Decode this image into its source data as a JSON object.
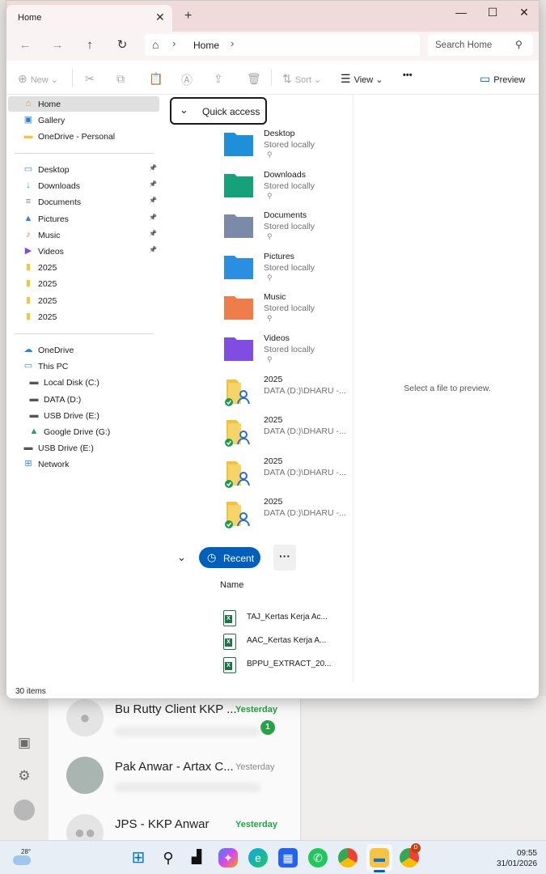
{
  "explorer": {
    "tab_title": "Home",
    "tab_close": "✕",
    "new_tab": "+",
    "window_controls": {
      "minimize": "—",
      "maximize": "☐",
      "close": "✕"
    },
    "address": {
      "crumb": "Home",
      "separator": "›"
    },
    "search_placeholder": "Search Home",
    "toolbar": {
      "new_label": "New",
      "sort_label": "Sort",
      "view_label": "View",
      "more_label": "•••",
      "preview_label": "Preview"
    },
    "sidebar": {
      "top": [
        {
          "label": "Home",
          "icon": "home-icon",
          "color": "#e8843a",
          "selected": true
        },
        {
          "label": "Gallery",
          "icon": "gallery-icon",
          "color": "#2d7fd3"
        },
        {
          "label": "OneDrive - Personal",
          "icon": "folder-icon",
          "color": "#f6c343"
        }
      ],
      "pinned": [
        {
          "label": "Desktop",
          "icon": "desktop-icon",
          "color": "#2a8fd8"
        },
        {
          "label": "Downloads",
          "icon": "download-icon",
          "color": "#1b9c6e"
        },
        {
          "label": "Documents",
          "icon": "documents-icon",
          "color": "#7c8aa6"
        },
        {
          "label": "Pictures",
          "icon": "pictures-icon",
          "color": "#2d86d8"
        },
        {
          "label": "Music",
          "icon": "music-icon",
          "color": "#e8703a"
        },
        {
          "label": "Videos",
          "icon": "videos-icon",
          "color": "#7e4bd8"
        },
        {
          "label": "2025",
          "icon": "shared-folder-icon",
          "color": "#f6c343"
        },
        {
          "label": "2025",
          "icon": "shared-folder-icon",
          "color": "#f6c343"
        },
        {
          "label": "2025",
          "icon": "shared-folder-icon",
          "color": "#f6c343"
        },
        {
          "label": "2025",
          "icon": "shared-folder-icon",
          "color": "#f6c343"
        }
      ],
      "drives": [
        {
          "label": "OneDrive",
          "icon": "cloud-icon",
          "color": "#2d86d8"
        },
        {
          "label": "This PC",
          "icon": "pc-icon",
          "color": "#2a8fd8"
        },
        {
          "label": "Local Disk (C:)",
          "icon": "windows-drive-icon",
          "color": "#555"
        },
        {
          "label": "DATA (D:)",
          "icon": "drive-icon",
          "color": "#555"
        },
        {
          "label": "USB Drive (E:)",
          "icon": "drive-icon",
          "color": "#555"
        },
        {
          "label": "Google Drive (G:)",
          "icon": "google-drive-icon",
          "color": "#1fa463"
        },
        {
          "label": "USB Drive (E:)",
          "icon": "drive-icon",
          "color": "#555"
        },
        {
          "label": "Network",
          "icon": "network-icon",
          "color": "#2a8fd8"
        }
      ]
    },
    "quick_access": {
      "header": "Quick access",
      "items": [
        {
          "name": "Desktop",
          "sub": "Stored locally",
          "icon": "desktop-folder-icon",
          "color": "#1f8fd8"
        },
        {
          "name": "Downloads",
          "sub": "Stored locally",
          "icon": "downloads-folder-icon",
          "color": "#18a17a"
        },
        {
          "name": "Documents",
          "sub": "Stored locally",
          "icon": "documents-folder-icon",
          "color": "#7b8aa8"
        },
        {
          "name": "Pictures",
          "sub": "Stored locally",
          "icon": "pictures-folder-icon",
          "color": "#2a8ee0"
        },
        {
          "name": "Music",
          "sub": "Stored locally",
          "icon": "music-folder-icon",
          "color": "#ee7d4a"
        },
        {
          "name": "Videos",
          "sub": "Stored locally",
          "icon": "videos-folder-icon",
          "color": "#7f4ee0"
        },
        {
          "name": "2025",
          "sub": "DATA (D:)\\DHARU -...",
          "icon": "shared-folder-icon",
          "color": "#f3c13c"
        },
        {
          "name": "2025",
          "sub": "DATA (D:)\\DHARU -...",
          "icon": "shared-folder-icon",
          "color": "#f3c13c"
        },
        {
          "name": "2025",
          "sub": "DATA (D:)\\DHARU -...",
          "icon": "shared-folder-icon",
          "color": "#f3c13c"
        },
        {
          "name": "2025",
          "sub": "DATA (D:)\\DHARU -...",
          "icon": "shared-folder-icon",
          "color": "#f3c13c"
        }
      ]
    },
    "recent": {
      "label": "Recent",
      "more": "···",
      "column_name": "Name",
      "files": [
        {
          "name": "TAJ_Kertas Kerja Ac..."
        },
        {
          "name": "AAC_Kertas Kerja A..."
        },
        {
          "name": "BPPU_EXTRACT_20..."
        }
      ]
    },
    "preview_text": "Select a file to preview.",
    "status": "30 items"
  },
  "background_chats": [
    {
      "name": "Bu Rutty Client KKP ...",
      "time": "Yesterday",
      "unread": "1"
    },
    {
      "name": "Pak Anwar - Artax C...",
      "time": "Yesterday",
      "unread": ""
    },
    {
      "name": "JPS - KKP Anwar",
      "time": "Yesterday",
      "unread": ""
    }
  ],
  "taskbar": {
    "weather_temp": "28°",
    "time": "09:55",
    "date": "31/01/2026",
    "chrome_badge": "D"
  }
}
